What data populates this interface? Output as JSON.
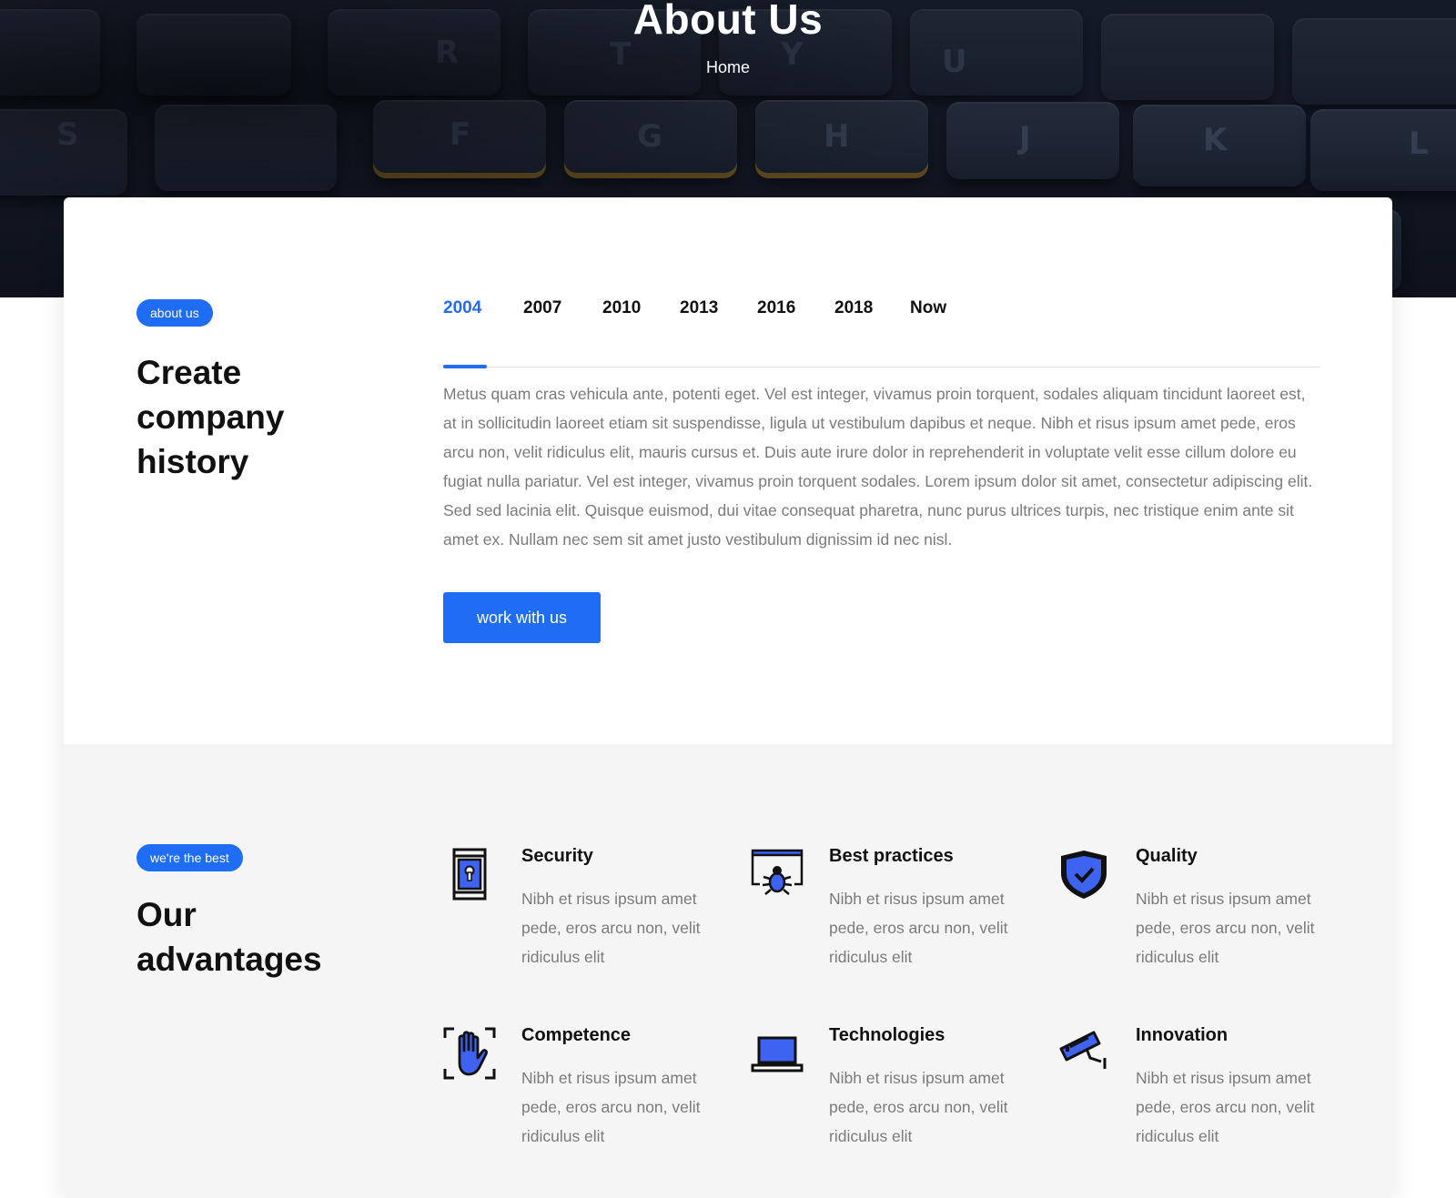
{
  "hero": {
    "title": "About Us",
    "breadcrumb": "Home"
  },
  "history": {
    "badge": "about us",
    "title": "Create company history",
    "tabs": [
      "2004",
      "2007",
      "2010",
      "2013",
      "2016",
      "2018",
      "Now"
    ],
    "active_tab": "2004",
    "text": "Metus quam cras vehicula ante, potenti eget. Vel est integer, vivamus proin torquent, sodales aliquam tincidunt laoreet est, at in sollicitudin laoreet etiam sit suspendisse, ligula ut vestibulum dapibus et neque. Nibh et risus ipsum amet pede, eros arcu non, velit ridiculus elit, mauris cursus et. Duis aute irure dolor in reprehenderit in voluptate velit esse cillum dolore eu fugiat nulla pariatur. Vel est integer, vivamus proin torquent sodales. Lorem ipsum dolor sit amet, consectetur adipiscing elit. Sed sed lacinia elit. Quisque euismod, dui vitae consequat pharetra, nunc purus ultrices turpis, nec tristique enim ante sit amet ex. Nullam nec sem sit amet justo vestibulum dignissim id nec nisl.",
    "button": "work with us"
  },
  "advantages": {
    "badge": "we're the best",
    "title": "Our advantages",
    "items": [
      {
        "title": "Security",
        "text": "Nibh et risus ipsum amet pede, eros arcu non, velit ridiculus elit",
        "icon": "keyhole-door-icon"
      },
      {
        "title": "Best practices",
        "text": "Nibh et risus ipsum amet pede, eros arcu non, velit ridiculus elit",
        "icon": "bug-screen-icon"
      },
      {
        "title": "Quality",
        "text": "Nibh et risus ipsum amet pede, eros arcu non, velit ridiculus elit",
        "icon": "shield-check-icon"
      },
      {
        "title": "Competence",
        "text": "Nibh et risus ipsum amet pede, eros arcu non, velit ridiculus elit",
        "icon": "hand-scan-icon"
      },
      {
        "title": "Technologies",
        "text": "Nibh et risus ipsum amet pede, eros arcu non, velit ridiculus elit",
        "icon": "laptop-icon"
      },
      {
        "title": "Innovation",
        "text": "Nibh et risus ipsum amet pede, eros arcu non, velit ridiculus elit",
        "icon": "security-camera-icon"
      }
    ]
  },
  "colors": {
    "accent": "#1f6df5",
    "heading": "#111111",
    "body_text": "#7b7b7b",
    "section_bg": "#f5f5f5",
    "icon_fill": "#3d63f0"
  }
}
